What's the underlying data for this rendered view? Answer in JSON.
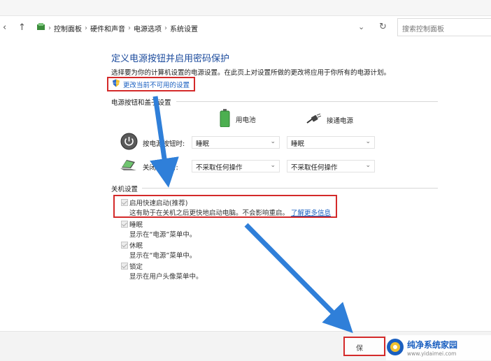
{
  "breadcrumb": {
    "items": [
      "控制面板",
      "硬件和声音",
      "电源选项",
      "系统设置"
    ]
  },
  "search": {
    "placeholder": "搜索控制面板"
  },
  "page": {
    "title": "定义电源按钮并启用密码保护",
    "description": "选择要为你的计算机设置的电源设置。在此页上对设置所做的更改将应用于你所有的电源计划。",
    "change_settings_link": "更改当前不可用的设置"
  },
  "power_section": {
    "label": "电源按钮和盖子设置",
    "columns": {
      "battery": "用电池",
      "plugged_in": "接通电源"
    },
    "rows": [
      {
        "label": "按电源按钮时:",
        "battery_value": "睡眠",
        "plugged_value": "睡眠"
      },
      {
        "label": "关闭盖子时:",
        "battery_value": "不采取任何操作",
        "plugged_value": "不采取任何操作"
      }
    ]
  },
  "shutdown_section": {
    "label": "关机设置",
    "options": [
      {
        "label": "启用快速启动(推荐)",
        "desc": "这有助于在关机之后更快地启动电脑。不会影响重启。",
        "link": "了解更多信息",
        "checked": true,
        "disabled": true
      },
      {
        "label": "睡眠",
        "desc": "显示在“电源”菜单中。",
        "checked": true,
        "disabled": true
      },
      {
        "label": "休眠",
        "desc": "显示在“电源”菜单中。",
        "checked": true,
        "disabled": true
      },
      {
        "label": "锁定",
        "desc": "显示在用户头像菜单中。",
        "checked": true,
        "disabled": true
      }
    ]
  },
  "footer": {
    "save_label": "保"
  },
  "watermark": {
    "name": "纯净系统家园",
    "url": "www.yidaimei.com"
  },
  "colors": {
    "accent": "#1a5fc0",
    "highlight": "#d42a2a",
    "arrow": "#2f7fd9",
    "title": "#1a4a9c"
  },
  "icons": [
    "back-arrow-icon",
    "up-arrow-icon",
    "control-panel-icon",
    "chevron-down-icon",
    "refresh-icon",
    "shield-icon",
    "battery-icon",
    "plug-icon",
    "power-icon",
    "laptop-lid-icon"
  ]
}
